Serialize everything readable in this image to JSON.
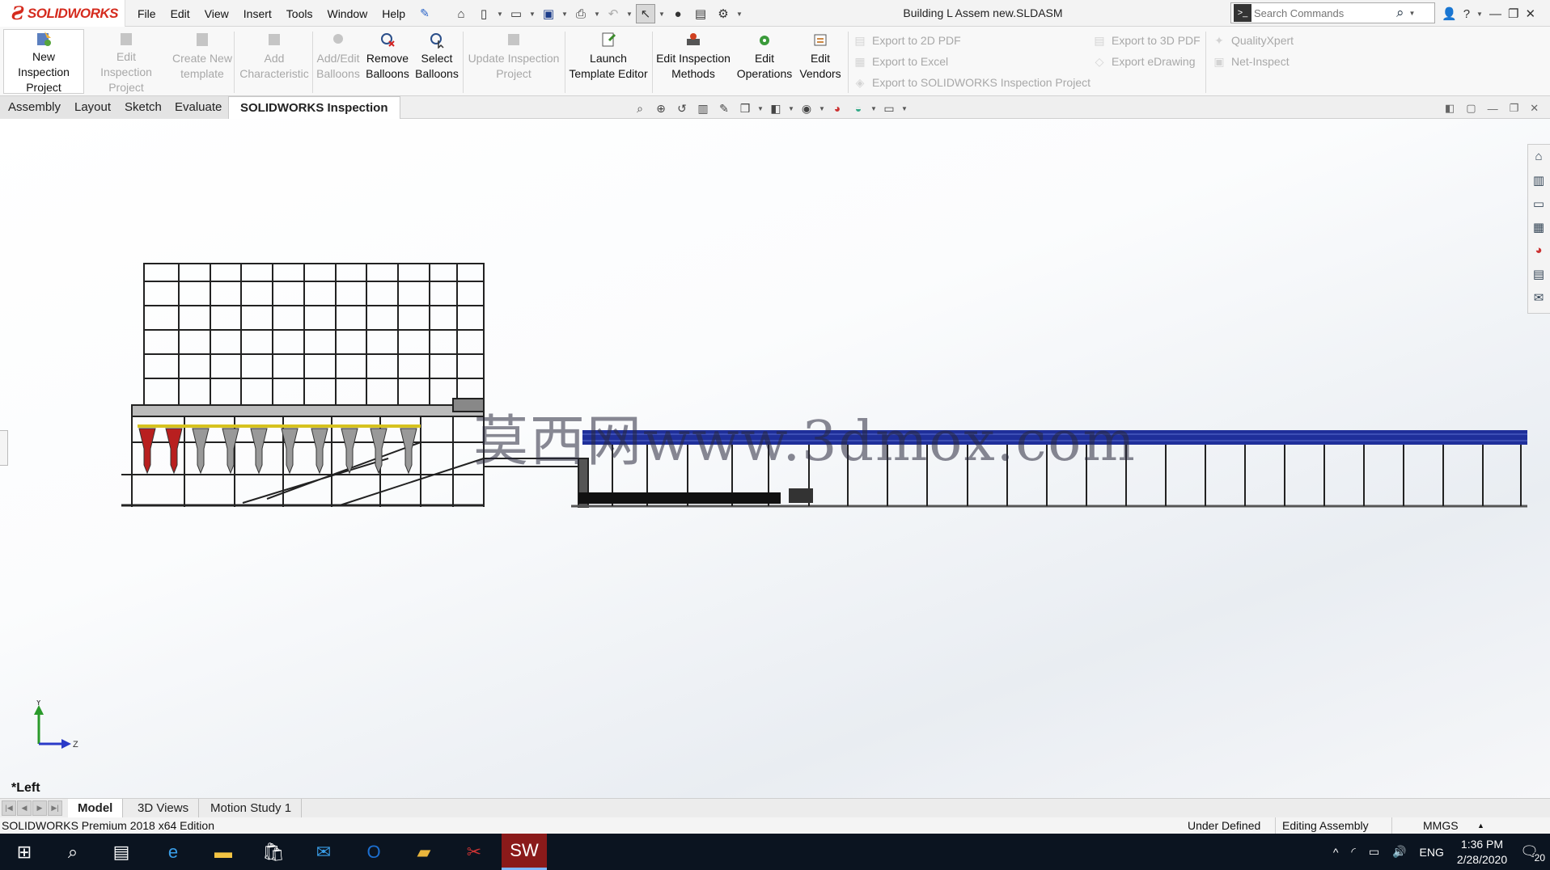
{
  "app": {
    "logo_text": "SOLIDWORKS",
    "doc_title": "Building L Assem new.SLDASM"
  },
  "menus": [
    "File",
    "Edit",
    "View",
    "Insert",
    "Tools",
    "Window",
    "Help"
  ],
  "search": {
    "placeholder": "Search Commands"
  },
  "ribbon": {
    "new_inspection_project": "New Inspection Project",
    "edit_inspection_project": "Edit Inspection Project",
    "create_new_template": "Create New template",
    "add_characteristic": "Add Characteristic",
    "add_edit_balloons": "Add/Edit Balloons",
    "remove_balloons": "Remove Balloons",
    "select_balloons": "Select Balloons",
    "update_inspection_project": "Update Inspection Project",
    "launch_template_editor": "Launch Template Editor",
    "edit_inspection_methods": "Edit Inspection Methods",
    "edit_operations": "Edit Operations",
    "edit_vendors": "Edit Vendors",
    "export_2d_pdf": "Export to 2D PDF",
    "export_excel": "Export to Excel",
    "export_sw_inspection": "Export to SOLIDWORKS Inspection Project",
    "export_3d_pdf": "Export to 3D PDF",
    "export_edrawing": "Export eDrawing",
    "qualityxpert": "QualityXpert",
    "net_inspect": "Net-Inspect"
  },
  "tabs": [
    "Assembly",
    "Layout",
    "Sketch",
    "Evaluate",
    "SOLIDWORKS Inspection"
  ],
  "viewport": {
    "view_label": "*Left",
    "axis_y": "Y",
    "axis_z": "Z",
    "watermark": "莫西网www.3dmox.com"
  },
  "bottom_tabs": [
    "Model",
    "3D Views",
    "Motion Study 1"
  ],
  "status": {
    "edition": "SOLIDWORKS Premium 2018 x64 Edition",
    "state": "Under Defined",
    "mode": "Editing Assembly",
    "units": "MMGS"
  },
  "taskbar": {
    "lang": "ENG",
    "time": "1:36 PM",
    "date": "2/28/2020",
    "notifications": "20"
  },
  "colors": {
    "accent": "#d52b1e",
    "conveyor": "#1f2f9a",
    "taskbar": "#0b1420"
  }
}
